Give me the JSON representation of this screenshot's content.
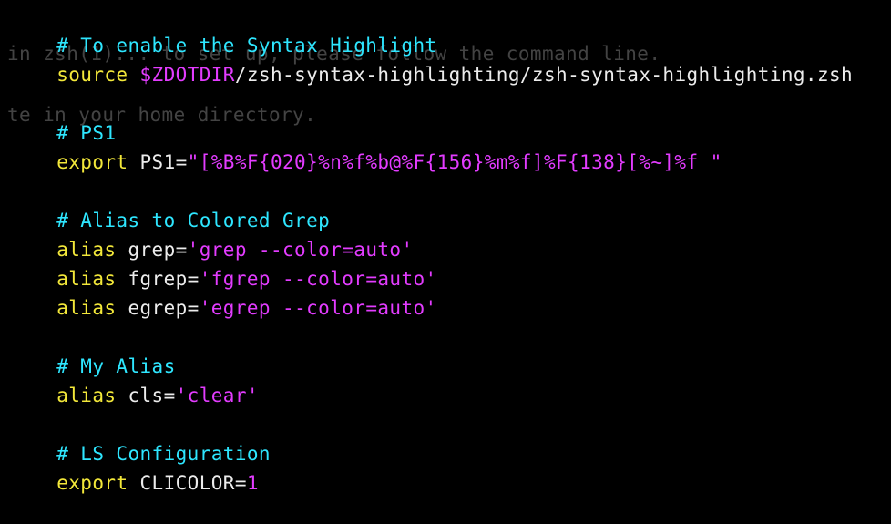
{
  "colors": {
    "background": "#000000",
    "comment": "#2ee6ff",
    "keyword": "#f3e83a",
    "string": "#e33cff",
    "text": "#ececec"
  },
  "ghost": {
    "line1": "in zsh(1)... to set up, please follow the command line.",
    "line2": "te in your home directory."
  },
  "code": {
    "l1_comment": "# To enable the Syntax Highlight",
    "l2_kw": "source",
    "l2_var": "$ZDOTDIR",
    "l2_rest": "/zsh-syntax-highlighting/zsh-syntax-highlighting.zsh",
    "l4_comment": "# PS1",
    "l5_kw": "export",
    "l5_name": " PS1=",
    "l5_str": "\"[%B%F{020}%n%f%b@%F{156}%m%f]%F{138}[%~]%f \"",
    "l7_comment": "# Alias to Colored Grep",
    "l8_kw": "alias",
    "l8_name": " grep=",
    "l8_str": "'grep --color=auto'",
    "l9_kw": "alias",
    "l9_name": " fgrep=",
    "l9_str": "'fgrep --color=auto'",
    "l10_kw": "alias",
    "l10_name": " egrep=",
    "l10_str": "'egrep --color=auto'",
    "l12_comment": "# My Alias",
    "l13_kw": "alias",
    "l13_name": " cls=",
    "l13_str": "'clear'",
    "l15_comment": "# LS Configuration",
    "l16_kw": "export",
    "l16_name": " CLICOLOR=",
    "l16_val": "1"
  }
}
